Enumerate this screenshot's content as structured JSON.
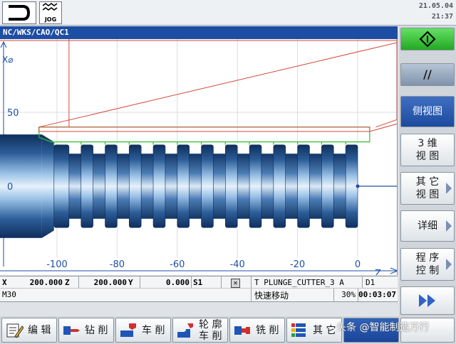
{
  "status": {
    "mode_icon": "machine-area-icon",
    "mode": "JOG",
    "date": "21.05.04",
    "time": "21:37"
  },
  "window": {
    "path": "NC/WKS/CAO/QC1"
  },
  "chart_data": {
    "type": "diagram",
    "ylabel": "X⌀",
    "xlabel": "Z",
    "y_ticks": [
      50,
      0
    ],
    "x_ticks": [
      -100,
      -80,
      -60,
      -40,
      -20,
      0
    ],
    "z_range": [
      -124,
      8
    ],
    "x_range": [
      -40,
      75
    ]
  },
  "readout": {
    "x_label": "X",
    "x_value": "200.000",
    "z_label": "Z",
    "z_value": "200.000",
    "y_label": "Y",
    "y_value": "0.000",
    "spindle": "S1",
    "tool": "T PLUNGE_CUTTER_3 A",
    "d_number": "D1",
    "m_function": "M30",
    "motion": "快速移动",
    "override": "30%",
    "elapsed": "00:03:07"
  },
  "vertical_softkeys": [
    {
      "label": "",
      "icon": "start-diamond-icon",
      "style": "green"
    },
    {
      "label": "//",
      "icon": "",
      "style": "steel"
    },
    {
      "label": "侧视图",
      "icon": "",
      "style": "blue"
    },
    {
      "label": "3 维\n视 图",
      "icon": "",
      "style": "normal"
    },
    {
      "label": "其 它\n视 图",
      "icon": "arrow",
      "style": "normal"
    },
    {
      "label": "详细",
      "icon": "arrow",
      "style": "normal"
    },
    {
      "label": "程 序\n控 制",
      "icon": "arrow",
      "style": "normal"
    },
    {
      "label": "",
      "icon": "double-chevron-right-icon",
      "style": "normal"
    }
  ],
  "horizontal_softkeys": [
    {
      "label": "编 辑",
      "icon": "edit-icon"
    },
    {
      "label": "钻 削",
      "icon": "drilling-icon"
    },
    {
      "label": "车 削",
      "icon": "turning-icon"
    },
    {
      "label": "轮 廓\n车 削",
      "icon": "contour-turning-icon"
    },
    {
      "label": "铣 削",
      "icon": "milling-icon"
    },
    {
      "label": "其 它",
      "icon": "various-icon"
    }
  ],
  "watermark": "头条 @智能制造万行"
}
